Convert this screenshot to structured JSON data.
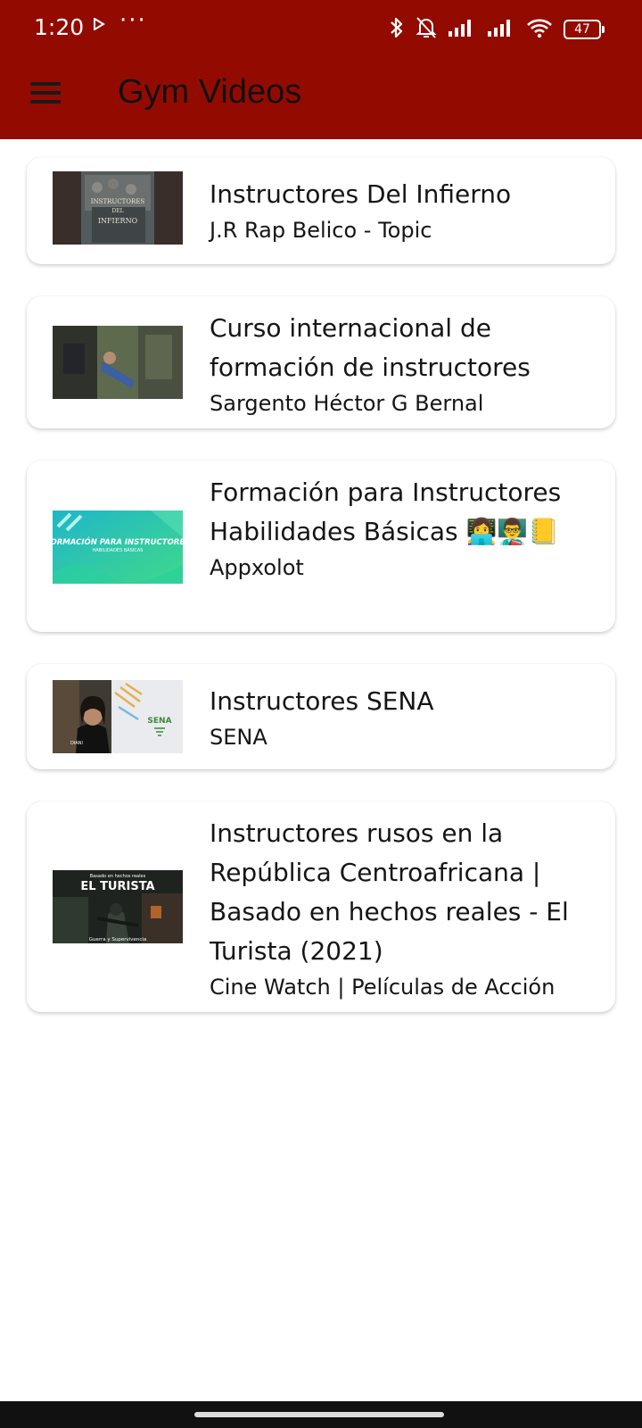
{
  "status": {
    "time": "1:20",
    "overflow": "···",
    "battery": "47",
    "icons": [
      "play-icon",
      "bluetooth-icon",
      "bell-off-icon",
      "signal-icon",
      "signal-icon",
      "wifi-icon",
      "battery-icon"
    ]
  },
  "app_bar": {
    "title": "Gym Videos",
    "menu_icon": "hamburger-menu-icon"
  },
  "colors": {
    "app_bar": "#930b00",
    "background": "#ffffff",
    "text": "#151515"
  },
  "videos": [
    {
      "title": "Instructores Del Infierno",
      "channel": "J.R Rap Belico - Topic",
      "thumb_text": [
        "INSTRUCTORES",
        "DEL",
        "INFIERNO"
      ]
    },
    {
      "title": "Curso internacional de formación de instructores",
      "channel": "Sargento Héctor G Bernal"
    },
    {
      "title": "Formación para Instructores Habilidades Básicas 👩‍💻👨‍🏫📒",
      "channel": "Appxolot",
      "thumb_text": [
        "FORMACIÓN PARA INSTRUCTORES",
        "HABILIDADES BÁSICAS"
      ]
    },
    {
      "title": "Instructores SENA",
      "channel": "SENA",
      "thumb_text": [
        "SENA",
        "DIANI"
      ]
    },
    {
      "title": "Instructores rusos en la República Centroafricana | Basado en hechos reales - El Turista (2021)",
      "channel": "Cine Watch | Películas de Acción",
      "thumb_text": [
        "Basado en hechos reales",
        "EL TURISTA",
        "Guerra y Supervivencia"
      ]
    }
  ]
}
